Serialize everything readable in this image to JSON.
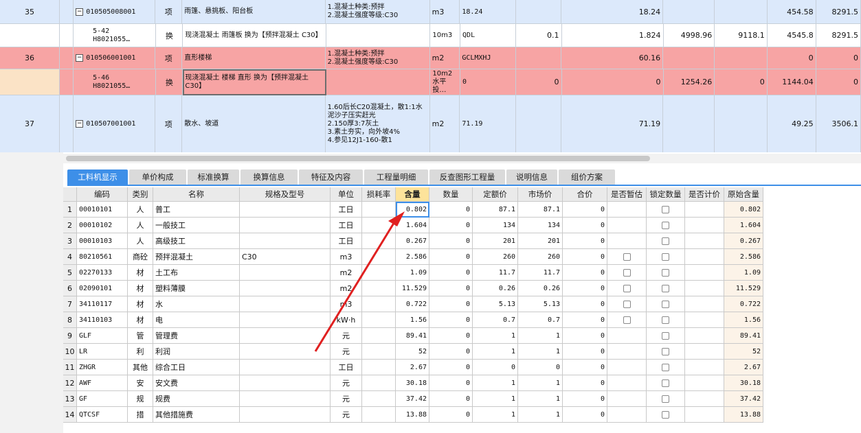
{
  "top_rows": [
    {
      "kind": "blue",
      "num": "35",
      "tree": "minus",
      "code": "010505008001",
      "type": "项",
      "name": "雨篷、悬挑板、阳台板",
      "feature": "1.混凝土种类:预拌\n2.混凝土强度等级:C30",
      "unit": "m3",
      "expr": "18.24",
      "c1": "",
      "c2": "18.24",
      "c3": "",
      "c4": "",
      "c5": "454.58",
      "c6": "8291.5"
    },
    {
      "kind": "white",
      "num": "",
      "tree": "leaf",
      "code": "5-42\nH8021055…",
      "type": "换",
      "name": "现浇混凝土 雨篷板  换为【预拌混凝土 C30】",
      "feature": "",
      "unit": "10m3",
      "expr": "QDL",
      "c1": "0.1",
      "c2": "1.824",
      "c3": "4998.96",
      "c4": "9118.1",
      "c5": "4545.8",
      "c6": "8291.5"
    },
    {
      "kind": "red",
      "num": "36",
      "tree": "minus",
      "code": "010506001001",
      "type": "项",
      "name": "直形楼梯",
      "feature": "1.混凝土种类:预拌\n2.混凝土强度等级:C30",
      "unit": "m2",
      "expr": "GCLMXHJ",
      "c1": "",
      "c2": "60.16",
      "c3": "",
      "c4": "",
      "c5": "0",
      "c6": "0"
    },
    {
      "kind": "red",
      "num": "",
      "tree": "leaf",
      "code": "5-46\nH8021055…",
      "type": "换",
      "name": "现浇混凝土 楼梯 直形  换为【预拌混凝土 C30】",
      "feature": "",
      "unit": "10m2水平投…",
      "expr": "0",
      "c1": "0",
      "c2": "0",
      "c3": "1254.26",
      "c4": "0",
      "c5": "1144.04",
      "c6": "0"
    },
    {
      "kind": "blue",
      "num": "37",
      "tree": "minus",
      "code": "010507001001",
      "type": "项",
      "name": "散水、坡道",
      "feature": "1.60后长C20混凝土，散1:1水泥沙子压实赶光\n2.150厚3:7灰土\n3.素土夯实，向外坡4%\n4.参见12J1-160-散1",
      "unit": "m2",
      "expr": "71.19",
      "c1": "",
      "c2": "71.19",
      "c3": "",
      "c4": "",
      "c5": "49.25",
      "c6": "3506.1"
    }
  ],
  "tabs": [
    "工料机显示",
    "单价构成",
    "标准换算",
    "换算信息",
    "特征及内容",
    "工程量明细",
    "反查图形工程量",
    "说明信息",
    "组价方案"
  ],
  "columns": [
    "编码",
    "类别",
    "名称",
    "规格及型号",
    "单位",
    "损耗率",
    "含量",
    "数量",
    "定额价",
    "市场价",
    "合价",
    "是否暂估",
    "锁定数量",
    "是否计价",
    "原始含量"
  ],
  "rows": [
    {
      "n": "1",
      "code": "00010101",
      "cat": "人",
      "name": "普工",
      "spec": "",
      "unit": "工日",
      "loss": "",
      "qty": "0.802",
      "num": "0",
      "price": "87.1",
      "market": "87.1",
      "total": "0",
      "est": "",
      "lock": "box",
      "calc": "",
      "orig": "0.802"
    },
    {
      "n": "2",
      "code": "00010102",
      "cat": "人",
      "name": "一般技工",
      "spec": "",
      "unit": "工日",
      "loss": "",
      "qty": "1.604",
      "num": "0",
      "price": "134",
      "market": "134",
      "total": "0",
      "est": "",
      "lock": "box",
      "calc": "",
      "orig": "1.604"
    },
    {
      "n": "3",
      "code": "00010103",
      "cat": "人",
      "name": "高级技工",
      "spec": "",
      "unit": "工日",
      "loss": "",
      "qty": "0.267",
      "num": "0",
      "price": "201",
      "market": "201",
      "total": "0",
      "est": "",
      "lock": "box",
      "calc": "",
      "orig": "0.267"
    },
    {
      "n": "4",
      "code": "80210561",
      "cat": "商砼",
      "name": "预拌混凝土",
      "spec": "C30",
      "unit": "m3",
      "loss": "",
      "qty": "2.586",
      "num": "0",
      "price": "260",
      "market": "260",
      "total": "0",
      "est": "box",
      "lock": "box",
      "calc": "",
      "orig": "2.586"
    },
    {
      "n": "5",
      "code": "02270133",
      "cat": "材",
      "name": "土工布",
      "spec": "",
      "unit": "m2",
      "loss": "",
      "qty": "1.09",
      "num": "0",
      "price": "11.7",
      "market": "11.7",
      "total": "0",
      "est": "box",
      "lock": "box",
      "calc": "",
      "orig": "1.09"
    },
    {
      "n": "6",
      "code": "02090101",
      "cat": "材",
      "name": "塑料薄膜",
      "spec": "",
      "unit": "m2",
      "loss": "",
      "qty": "11.529",
      "num": "0",
      "price": "0.26",
      "market": "0.26",
      "total": "0",
      "est": "box",
      "lock": "box",
      "calc": "",
      "orig": "11.529"
    },
    {
      "n": "7",
      "code": "34110117",
      "cat": "材",
      "name": "水",
      "spec": "",
      "unit": "m3",
      "loss": "",
      "qty": "0.722",
      "num": "0",
      "price": "5.13",
      "market": "5.13",
      "total": "0",
      "est": "box",
      "lock": "box",
      "calc": "",
      "orig": "0.722"
    },
    {
      "n": "8",
      "code": "34110103",
      "cat": "材",
      "name": "电",
      "spec": "",
      "unit": "kW·h",
      "loss": "",
      "qty": "1.56",
      "num": "0",
      "price": "0.7",
      "market": "0.7",
      "total": "0",
      "est": "box",
      "lock": "box",
      "calc": "",
      "orig": "1.56"
    },
    {
      "n": "9",
      "code": "GLF",
      "cat": "管",
      "name": "管理费",
      "spec": "",
      "unit": "元",
      "loss": "",
      "qty": "89.41",
      "num": "0",
      "price": "1",
      "market": "1",
      "total": "0",
      "est": "",
      "lock": "box",
      "calc": "",
      "orig": "89.41"
    },
    {
      "n": "10",
      "code": "LR",
      "cat": "利",
      "name": "利润",
      "spec": "",
      "unit": "元",
      "loss": "",
      "qty": "52",
      "num": "0",
      "price": "1",
      "market": "1",
      "total": "0",
      "est": "",
      "lock": "box",
      "calc": "",
      "orig": "52"
    },
    {
      "n": "11",
      "code": "ZHGR",
      "cat": "其他",
      "name": "综合工日",
      "spec": "",
      "unit": "工日",
      "loss": "",
      "qty": "2.67",
      "num": "0",
      "price": "0",
      "market": "0",
      "total": "0",
      "est": "",
      "lock": "box",
      "calc": "",
      "orig": "2.67"
    },
    {
      "n": "12",
      "code": "AWF",
      "cat": "安",
      "name": "安文费",
      "spec": "",
      "unit": "元",
      "loss": "",
      "qty": "30.18",
      "num": "0",
      "price": "1",
      "market": "1",
      "total": "0",
      "est": "",
      "lock": "box",
      "calc": "",
      "orig": "30.18"
    },
    {
      "n": "13",
      "code": "GF",
      "cat": "规",
      "name": "规费",
      "spec": "",
      "unit": "元",
      "loss": "",
      "qty": "37.42",
      "num": "0",
      "price": "1",
      "market": "1",
      "total": "0",
      "est": "",
      "lock": "box",
      "calc": "",
      "orig": "37.42"
    },
    {
      "n": "14",
      "code": "QTCSF",
      "cat": "措",
      "name": "其他措施费",
      "spec": "",
      "unit": "元",
      "loss": "",
      "qty": "13.88",
      "num": "0",
      "price": "1",
      "market": "1",
      "total": "0",
      "est": "",
      "lock": "box",
      "calc": "",
      "orig": "13.88"
    }
  ],
  "colors": {
    "accent": "#3d8fe8",
    "row_blue": "#dce9fb",
    "row_red": "#f7a4a4",
    "header_highlight": "#fde39b",
    "annotation_arrow": "#e02020"
  },
  "icons": {
    "tree_toggle": "minus-box-icon",
    "annotation": "red-arrow-icon"
  }
}
